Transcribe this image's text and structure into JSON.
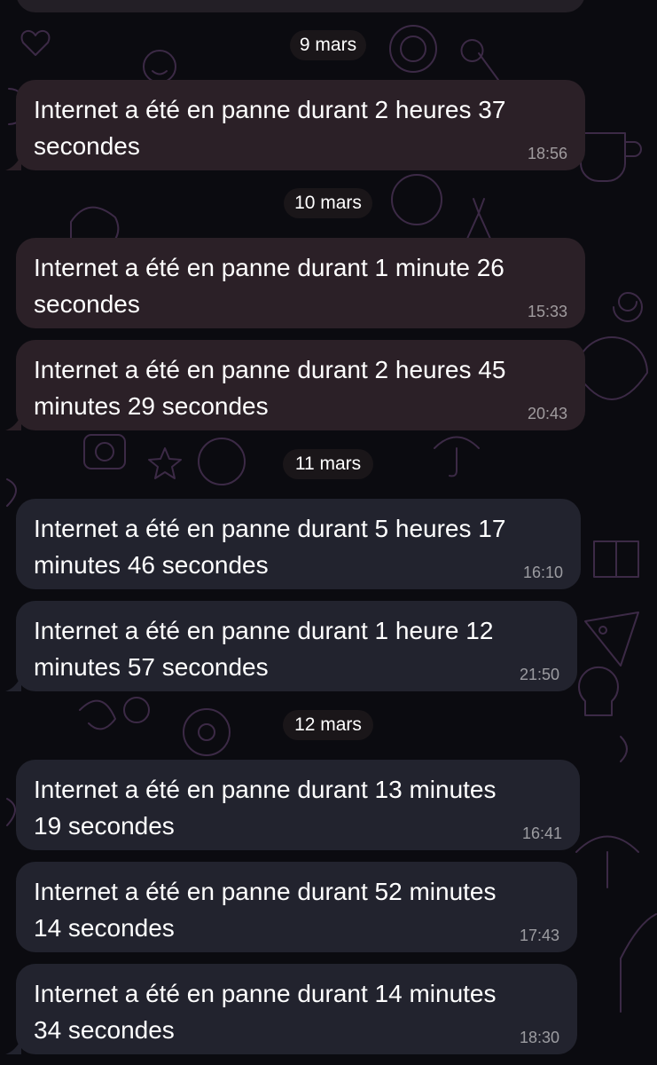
{
  "theme": {
    "background": "#0b0b10",
    "bubble_bg_warm": "#2b2027",
    "bubble_bg_cool": "#22232e",
    "date_pill_bg": "#1a1619",
    "doodle_color": "#3c2a46"
  },
  "chat": {
    "sections": [
      {
        "date": "9 mars",
        "messages": [
          {
            "text_line1": "Internet a été en panne durant 2 heures 37",
            "text_line2": "secondes",
            "time": "18:56"
          }
        ]
      },
      {
        "date": "10 mars",
        "messages": [
          {
            "text_line1": "Internet a été en panne durant 1 minute 26",
            "text_line2": "secondes",
            "time": "15:33"
          },
          {
            "text_line1": "Internet a été en panne durant 2 heures 45",
            "text_line2": "minutes 29 secondes",
            "time": "20:43"
          }
        ]
      },
      {
        "date": "11 mars",
        "messages": [
          {
            "text_line1": "Internet a été en panne durant 5 heures 17",
            "text_line2": "minutes 46 secondes",
            "time": "16:10"
          },
          {
            "text_line1": "Internet a été en panne durant 1 heure 12",
            "text_line2": "minutes 57 secondes",
            "time": "21:50"
          }
        ]
      },
      {
        "date": "12 mars",
        "messages": [
          {
            "text_line1": "Internet a été en panne durant 13 minutes",
            "text_line2": "19 secondes",
            "time": "16:41"
          },
          {
            "text_line1": "Internet a été en panne durant 52 minutes",
            "text_line2": "14 secondes",
            "time": "17:43"
          },
          {
            "text_line1": "Internet a été en panne durant 14 minutes",
            "text_line2": "34 secondes",
            "time": "18:30"
          }
        ]
      }
    ]
  }
}
